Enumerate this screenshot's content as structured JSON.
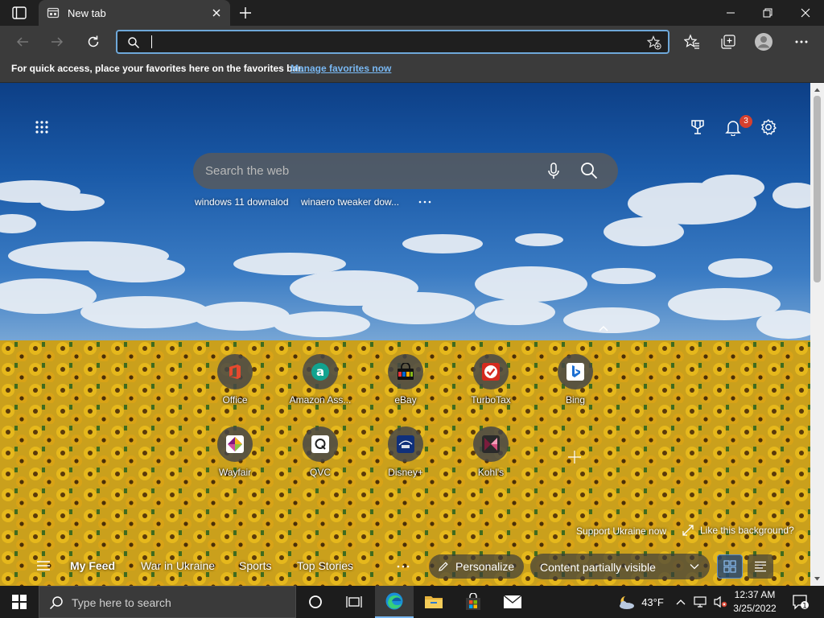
{
  "browser": {
    "tab": {
      "title": "New tab"
    },
    "address_bar": {
      "value": "",
      "placeholder": ""
    }
  },
  "favorites_bar": {
    "message": "For quick access, place your favorites here on the favorites bar.",
    "link": "Manage favorites now"
  },
  "newtab": {
    "notification_count": "3",
    "search": {
      "placeholder": "Search the web"
    },
    "trending": [
      "windows 11 downalod",
      "winaero tweaker dow..."
    ],
    "quick_links": [
      {
        "label": "Office",
        "icon": "office-icon",
        "color": "#e8492e"
      },
      {
        "label": "Amazon Ass...",
        "icon": "amazon-assistant-icon",
        "color": "#12a38f"
      },
      {
        "label": "eBay",
        "icon": "ebay-icon",
        "color": "#2a2a2a"
      },
      {
        "label": "TurboTax",
        "icon": "turbotax-icon",
        "color": "#d52b1e"
      },
      {
        "label": "Bing",
        "icon": "bing-icon",
        "color": "#1d6fd1"
      },
      {
        "label": "Wayfair",
        "icon": "wayfair-icon",
        "color": "#7f187f"
      },
      {
        "label": "QVC",
        "icon": "qvc-icon",
        "color": "#ffffff"
      },
      {
        "label": "Disney+",
        "icon": "disney-plus-icon",
        "color": "#10307a"
      },
      {
        "label": "Kohl's",
        "icon": "kohls-icon",
        "color": "#7a1d3c"
      }
    ],
    "support_link": "Support Ukraine now",
    "like_background": "Like this background?",
    "feed": {
      "items": [
        "My Feed",
        "War in Ukraine",
        "Sports",
        "Top Stories"
      ],
      "active": "My Feed",
      "personalize": "Personalize",
      "content_visibility": "Content partially visible"
    }
  },
  "taskbar": {
    "search_placeholder": "Type here to search",
    "weather": "43°F",
    "time": "12:37 AM",
    "date": "3/25/2022",
    "notification_count": "1",
    "apps": [
      "cortana-icon",
      "task-view-icon",
      "edge-icon",
      "file-explorer-icon",
      "microsoft-store-icon",
      "mail-icon"
    ]
  },
  "colors": {
    "accent": "#79b8f3",
    "tab_bg": "#3b3b3b",
    "titlebar_bg": "#202020",
    "taskbar_bg": "#1c1c1c",
    "badge": "#d6402e"
  }
}
